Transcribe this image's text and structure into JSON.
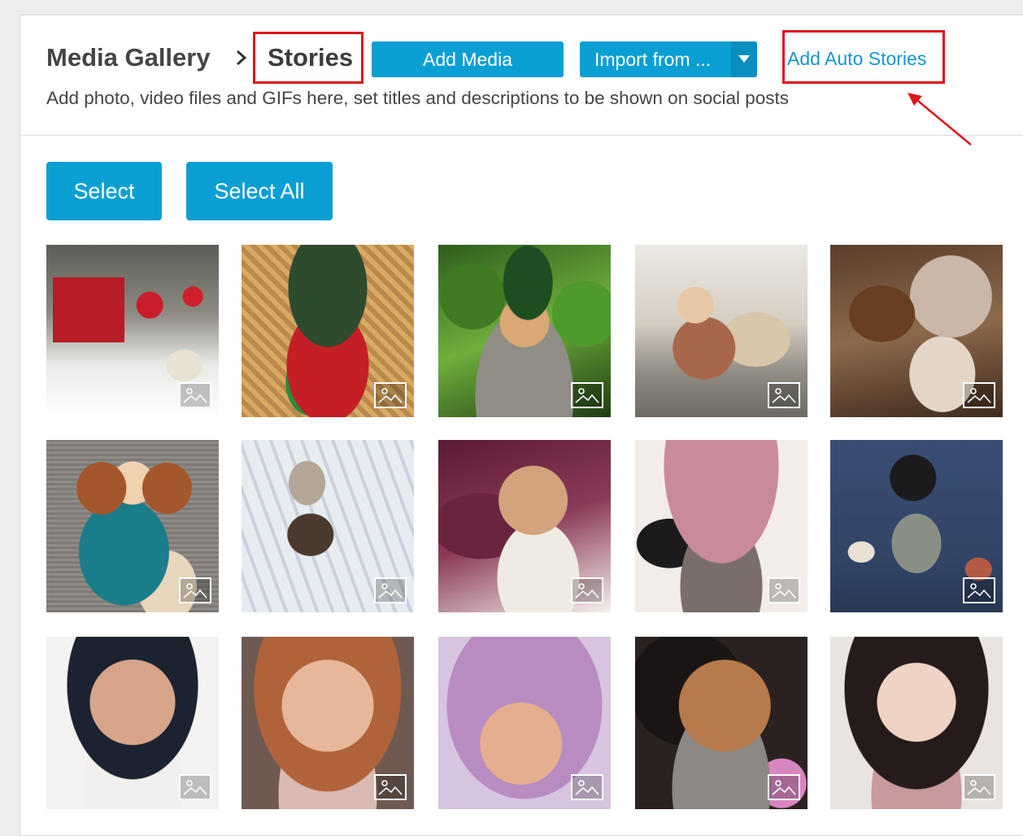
{
  "header": {
    "breadcrumb_root": "Media Gallery",
    "breadcrumb_current": "Stories",
    "add_media_label": "Add Media",
    "import_label": "Import from ...",
    "add_auto_stories_label": "Add Auto Stories",
    "subtitle": "Add photo, video files and GIFs here, set titles and descriptions to be shown on social posts"
  },
  "toolbar": {
    "select_label": "Select",
    "select_all_label": "Select All"
  },
  "colors": {
    "accent": "#0a9fd3",
    "highlight_red": "#e0141b",
    "link_blue": "#1594d6"
  },
  "gallery": {
    "item_icon": "image-icon",
    "items": [
      {
        "subject": "christmas-gift-and-ornaments"
      },
      {
        "subject": "clown-doll"
      },
      {
        "subject": "doll-green-hat-leaves"
      },
      {
        "subject": "vintage-plush-dolls"
      },
      {
        "subject": "doll-in-basket"
      },
      {
        "subject": "knitted-doll-blue-dress"
      },
      {
        "subject": "doll-in-snowy-branches"
      },
      {
        "subject": "blythe-doll-purple-hair"
      },
      {
        "subject": "blythe-doll-pink-hat"
      },
      {
        "subject": "blythe-doll-blue-background"
      },
      {
        "subject": "blythe-doll-black-hair"
      },
      {
        "subject": "blythe-doll-auburn-hair"
      },
      {
        "subject": "blythe-doll-lilac-hair"
      },
      {
        "subject": "blythe-doll-tan-skin"
      },
      {
        "subject": "blythe-doll-pink-overalls"
      }
    ]
  }
}
